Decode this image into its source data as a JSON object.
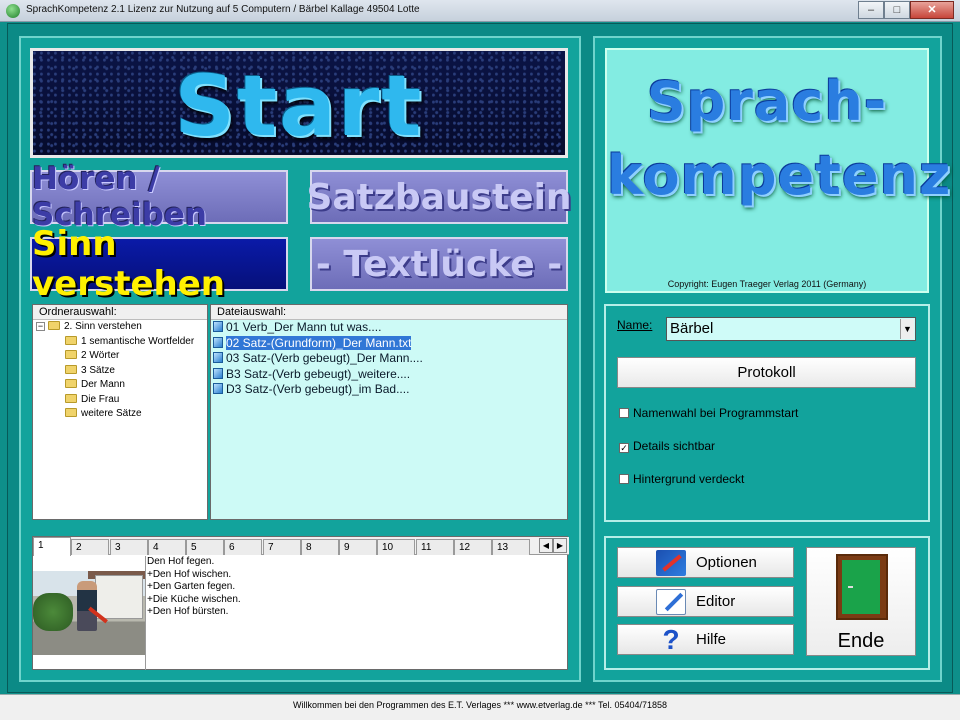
{
  "window": {
    "title": "SprachKompetenz 2.1   Lizenz zur Nutzung auf 5 Computern / Bärbel Kallage  49504 Lotte",
    "buttons": {
      "minimize": "–",
      "maximize": "□",
      "close": "✕"
    }
  },
  "banner": {
    "text": "Start"
  },
  "modes": [
    {
      "label": "Hören / Schreiben",
      "active": false
    },
    {
      "label": "Satzbaustein",
      "active": false
    },
    {
      "label": "Sinn verstehen",
      "active": true
    },
    {
      "label": "- Textlücke -",
      "active": false
    }
  ],
  "folder_panel": {
    "header": "Ordnerauswahl:",
    "root": "2. Sinn verstehen",
    "expander": "−",
    "items": [
      "1 semantische Wortfelder",
      "2 Wörter",
      "3 Sätze",
      "Der Mann",
      "Die Frau",
      "weitere Sätze"
    ]
  },
  "file_panel": {
    "header": "Dateiauswahl:",
    "items": [
      "01 Verb_Der Mann tut was....",
      "02 Satz-(Grundform)_Der Mann.txt",
      "03 Satz-(Verb gebeugt)_Der Mann....",
      "B3 Satz-(Verb gebeugt)_weitere....",
      "D3 Satz-(Verb gebeugt)_im Bad...."
    ],
    "selected_index": 1
  },
  "detail": {
    "tabs": [
      "1",
      "2",
      "3",
      "4",
      "5",
      "6",
      "7",
      "8",
      "9",
      "10",
      "11",
      "12",
      "13"
    ],
    "active_tab": "1",
    "sentences": [
      "Den Hof fegen.",
      "+Den Hof wischen.",
      "+Den Garten fegen.",
      "+Die Küche wischen.",
      "+Den Hof bürsten."
    ]
  },
  "logo": {
    "line1": "Sprach-",
    "line2": "kompetenz",
    "copyright": "Copyright:  Eugen Traeger Verlag   2011 (Germany)"
  },
  "settings": {
    "name_label": "Name:",
    "name_value": "Bärbel",
    "protokoll_label": "Protokoll",
    "checks": [
      {
        "label": "Namenwahl bei Programmstart",
        "checked": false
      },
      {
        "label": "Details sichtbar",
        "checked": true
      },
      {
        "label": "Hintergrund verdeckt",
        "checked": false
      }
    ]
  },
  "actions": {
    "optionen": "Optionen",
    "editor": "Editor",
    "hilfe": "Hilfe",
    "ende": "Ende"
  },
  "statusbar": {
    "text": "Willkommen bei den Programmen des E.T. Verlages   *** www.etverlag.de *** Tel. 05404/71858"
  }
}
